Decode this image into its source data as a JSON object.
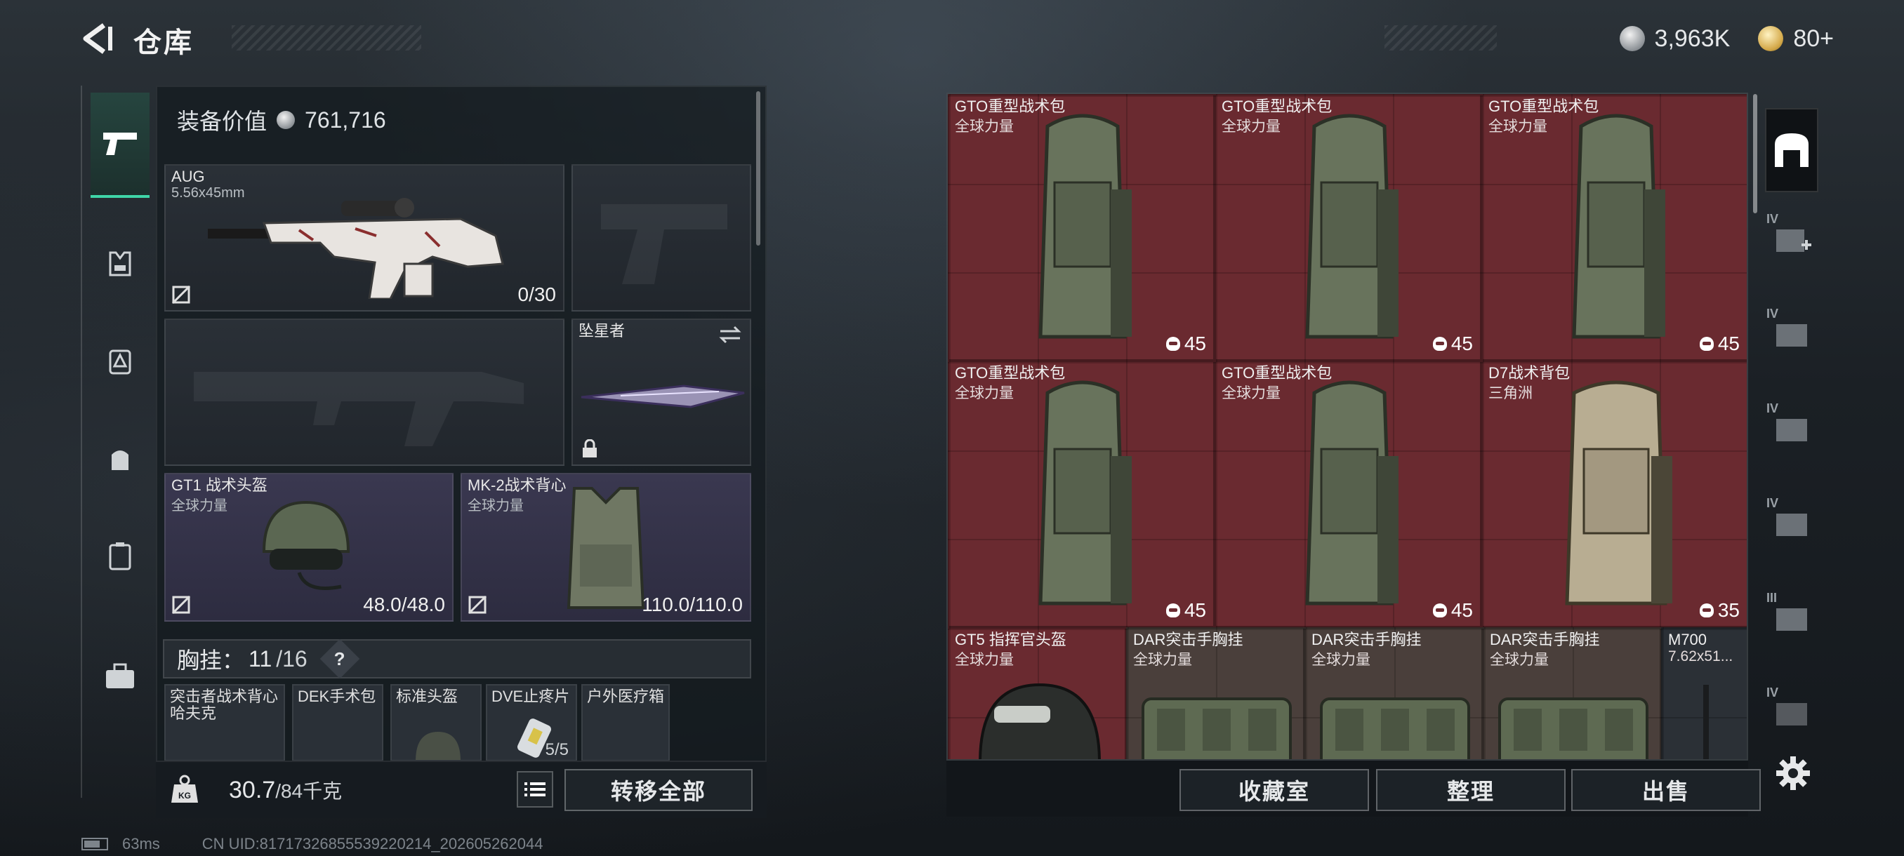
{
  "header": {
    "title": "仓库"
  },
  "currency": {
    "silver": "3,963K",
    "gold": "80+"
  },
  "equipment": {
    "value_label": "装备价值",
    "value": "761,716",
    "weapon_primary": {
      "name": "AUG",
      "caliber": "5.56x45mm",
      "ammo": "0/30"
    },
    "melee": {
      "name": "坠星者"
    },
    "helmet": {
      "name": "GT1 战术头盔",
      "maker": "全球力量",
      "durability": "48.0/48.0"
    },
    "armor": {
      "name": "MK-2战术背心",
      "maker": "全球力量",
      "durability": "110.0/110.0"
    },
    "chest_rig": {
      "label": "胸挂：",
      "count": "11",
      "capacity": "/16",
      "help": "?"
    },
    "chest_items": [
      {
        "name": "突击者战术背心",
        "sub": "哈夫克"
      },
      {
        "name": "DEK手术包"
      },
      {
        "name": "标准头盔"
      },
      {
        "name": "DVE止疼片",
        "count": "5/5"
      },
      {
        "name": "户外医疗箱"
      }
    ],
    "weight": "30.7",
    "weight_max": "/84千克",
    "transfer_all": "转移全部"
  },
  "status": {
    "ping": "63ms",
    "uid": "CN UID:81717326855539220214_202605262044"
  },
  "warehouse": {
    "items": [
      {
        "name": "GTO重型战术包",
        "maker": "全球力量",
        "capacity": "45"
      },
      {
        "name": "GTO重型战术包",
        "maker": "全球力量",
        "capacity": "45"
      },
      {
        "name": "GTO重型战术包",
        "maker": "全球力量",
        "capacity": "45"
      },
      {
        "name": "GTO重型战术包",
        "maker": "全球力量",
        "capacity": "45"
      },
      {
        "name": "GTO重型战术包",
        "maker": "全球力量",
        "capacity": "45"
      },
      {
        "name": "D7战术背包",
        "maker": "三角洲",
        "capacity": "35"
      },
      {
        "name": "GT5 指挥官头盔",
        "maker": "全球力量"
      },
      {
        "name": "DAR突击手胸挂",
        "maker": "全球力量"
      },
      {
        "name": "DAR突击手胸挂",
        "maker": "全球力量"
      },
      {
        "name": "DAR突击手胸挂",
        "maker": "全球力量"
      },
      {
        "name": "M700",
        "maker": "7.62x51..."
      }
    ],
    "actions": {
      "collection": "收藏室",
      "sort": "整理",
      "sell": "出售"
    },
    "tiers": [
      "IV",
      "IV",
      "IV",
      "IV",
      "III",
      "IV"
    ]
  },
  "colors": {
    "accent": "#3fd6a8",
    "rare_red": "#6a2a30",
    "purple": "#3a3850"
  }
}
